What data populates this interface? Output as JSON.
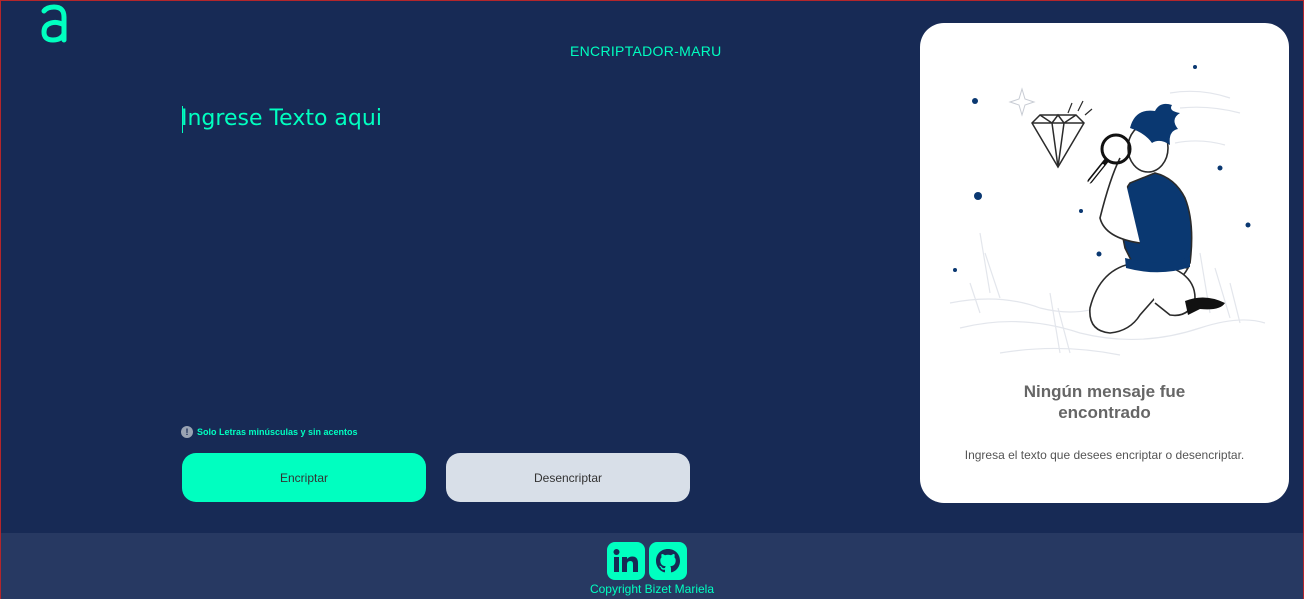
{
  "header": {
    "logo_icon": "alura-a-logo-icon",
    "title": "ENCRIPTADOR-MARU"
  },
  "editor": {
    "placeholder": "Ingrese Texto aqui",
    "value": ""
  },
  "hint": {
    "icon": "exclamation-circle-icon",
    "text": "Solo Letras minúsculas y sin acentos"
  },
  "buttons": {
    "encrypt": "Encriptar",
    "decrypt": "Desencriptar"
  },
  "output_card": {
    "illustration": "person-magnifying-glass-diamond-illustration",
    "title": "Ningún mensaje fue encontrado",
    "subtitle": "Ingresa el texto que desees encriptar o desencriptar."
  },
  "footer": {
    "links": [
      {
        "icon": "linkedin-icon"
      },
      {
        "icon": "github-icon"
      }
    ],
    "copyright": "Copyright Bizet Mariela"
  },
  "colors": {
    "background": "#172A55",
    "accent": "#00FFC0",
    "footer": "#273962",
    "secondary_button": "#D8DFE8",
    "illustration_blue": "#0A3871"
  }
}
